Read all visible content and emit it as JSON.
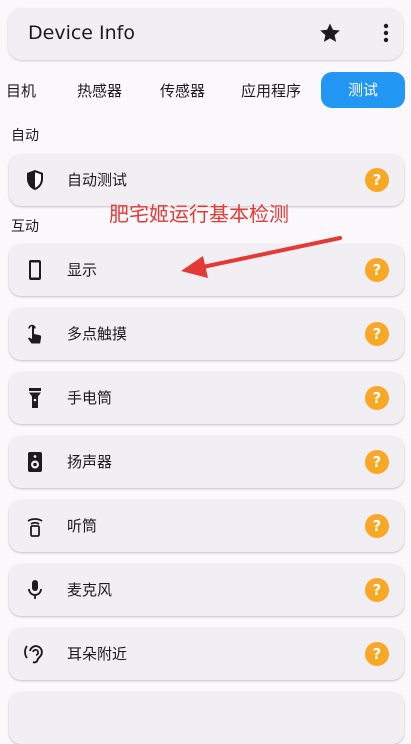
{
  "app": {
    "title": "Device Info"
  },
  "tabs": [
    "目机",
    "热感器",
    "传感器",
    "应用程序",
    "测试"
  ],
  "sections": {
    "auto": "自动",
    "interactive": "互动"
  },
  "cards": [
    {
      "label": "自动测试",
      "icon": "shield-icon"
    },
    {
      "label": "显示",
      "icon": "phone-icon"
    },
    {
      "label": "多点触摸",
      "icon": "touch-icon"
    },
    {
      "label": "手电筒",
      "icon": "flashlight-icon"
    },
    {
      "label": "扬声器",
      "icon": "speaker-icon"
    },
    {
      "label": "听筒",
      "icon": "earpiece-icon"
    },
    {
      "label": "麦克风",
      "icon": "microphone-icon"
    },
    {
      "label": "耳朵附近",
      "icon": "ear-proximity-icon"
    }
  ],
  "help_symbol": "?",
  "annotation": {
    "text": "肥宅姬运行基本检测",
    "color": "#e53935"
  },
  "colors": {
    "accent": "#2196f3",
    "help": "#f9a825",
    "card": "#f2eff4"
  }
}
